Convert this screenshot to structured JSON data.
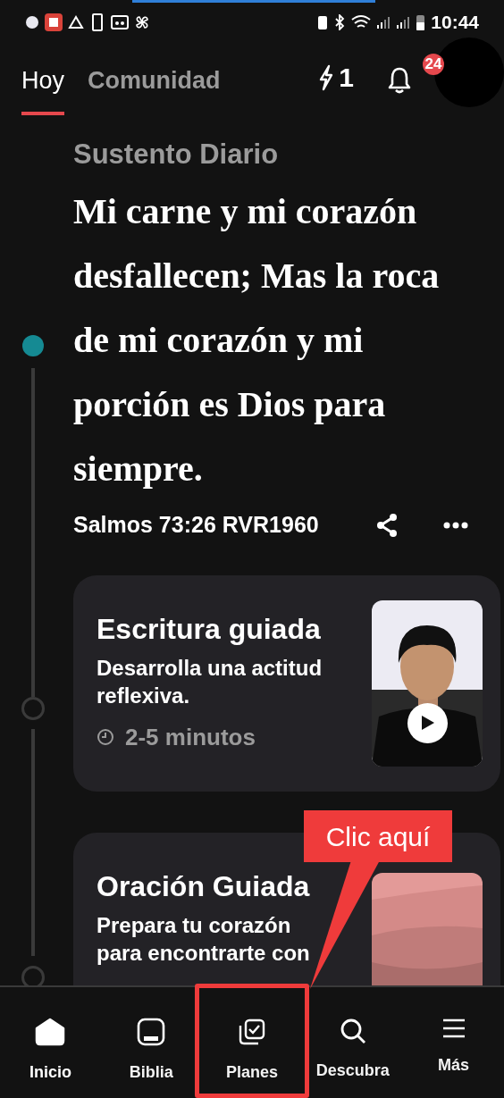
{
  "status_bar": {
    "time": "10:44"
  },
  "tabs": [
    {
      "label": "Hoy",
      "selected": true
    },
    {
      "label": "Comunidad",
      "selected": false
    }
  ],
  "streak": {
    "count": "1"
  },
  "notifications": {
    "badge": "24"
  },
  "section_title": "Sustento Diario",
  "verse": {
    "text": "Mi carne y mi corazón desfallecen; Mas la roca de mi corazón y mi porción es Dios para siempre.",
    "reference": "Salmos 73:26 RVR1960"
  },
  "cards": [
    {
      "kind": "video",
      "title": "Escritura guiada",
      "subtitle": "Desarrolla una actitud reflexiva.",
      "duration": "2-5 minutos"
    },
    {
      "kind": "picture",
      "title": "Oración Guiada",
      "subtitle": "Prepara tu corazón para encontrarte con"
    }
  ],
  "nav": [
    {
      "kind": "home",
      "label": "Inicio",
      "selected": true
    },
    {
      "kind": "bible",
      "label": "Biblia",
      "selected": false
    },
    {
      "kind": "plans",
      "label": "Planes",
      "selected": false
    },
    {
      "kind": "search",
      "label": "Descubra",
      "selected": false
    },
    {
      "kind": "menu",
      "label": "Más",
      "selected": false
    }
  ],
  "callout": {
    "text": "Clic aquí"
  }
}
